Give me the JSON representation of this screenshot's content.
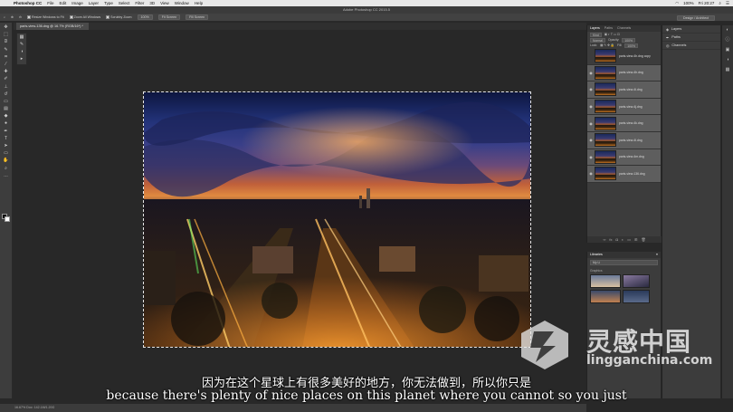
{
  "menubar": {
    "app_name": "Photoshop CC",
    "items": [
      "File",
      "Edit",
      "Image",
      "Layer",
      "Type",
      "Select",
      "Filter",
      "3D",
      "View",
      "Window",
      "Help"
    ],
    "battery": "100%",
    "clock": "Fri 20:27",
    "apple_icon": "apple-icon"
  },
  "window_title": "Adobe Photoshop CC 2015.5",
  "options": {
    "resize_windows": "Resize Windows to Fit",
    "zoom_all": "Zoom All Windows",
    "scrubby_zoom": "Scrubby Zoom",
    "zoom_value": "100%",
    "fit_screen": "Fit Screen",
    "fill_screen": "Fill Screen",
    "workspace": "Design / Architect"
  },
  "document": {
    "tab_label": "paris-view-136.dng @ 16.7% (RGB/16*) *"
  },
  "status": {
    "text": "16.67%    Doc: 142.1M/1.20G"
  },
  "layers_panel": {
    "tabs": [
      "Layers",
      "Paths",
      "Channels"
    ],
    "kind_filter": "Kind",
    "blend_mode": "Normal",
    "opacity_label": "Opacity:",
    "opacity": "100%",
    "lock_label": "Lock:",
    "fill_label": "Fill:",
    "fill": "100%",
    "layers": [
      {
        "name": "paris-view-4h.dng copy",
        "selected": false
      },
      {
        "name": "paris-view-4h.dng",
        "selected": true
      },
      {
        "name": "paris-view-4i.dng",
        "selected": true
      },
      {
        "name": "paris-view-4j.dng",
        "selected": true
      },
      {
        "name": "paris-view-4k.dng",
        "selected": true
      },
      {
        "name": "paris-view-4l.dng",
        "selected": true
      },
      {
        "name": "paris-view-4m.dng",
        "selected": true
      },
      {
        "name": "paris-view-136.dng",
        "selected": true
      }
    ]
  },
  "right_panel": {
    "items": [
      "Layers",
      "Paths",
      "Channels"
    ]
  },
  "libraries_panel": {
    "title": "Libraries",
    "library_name": "My Li",
    "section": "Graphics"
  },
  "subtitles": {
    "chinese": "因为在这个星球上有很多美好的地方，你无法做到，所以你只是",
    "english": "because there's plenty of nice places on this planet where you cannot so you just"
  },
  "watermark": {
    "name": "灵感中国",
    "url": "lingganchina.com"
  }
}
